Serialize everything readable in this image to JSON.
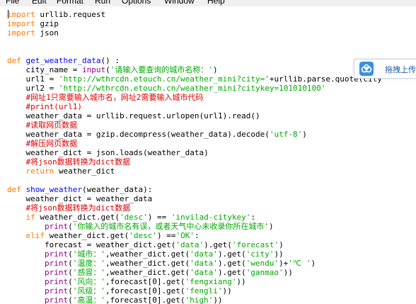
{
  "menu": {
    "items": [
      "File",
      "Edit",
      "Format",
      "Run",
      "Options",
      "Window",
      "Help"
    ]
  },
  "upload_widget": {
    "label": "拖拽上传",
    "icon": "cloud-upload-icon",
    "color": "#3a8ee6"
  },
  "code": {
    "l1_kw": "import",
    "l1_rest": " urllib.request",
    "l2_kw": "import",
    "l2_rest": " gzip",
    "l3_kw": "import",
    "l3_rest": " json",
    "l6_kw": "def",
    "l6_fn": "get_weather_data",
    "l6_rest": "() :",
    "l7_a": "    city_name = ",
    "l7_bi": "input",
    "l7_b": "(",
    "l7_str": "'请输入要查询的城市名称：'",
    "l7_c": ")",
    "l8_a": "    url1 = ",
    "l8_str": "'http://wthrcdn.etouch.cn/weather_mini?city='",
    "l8_b": "+urllib.parse.quote(city",
    "l9_a": "    url2 = ",
    "l9_str": "'http://wthrcdn.etouch.cn/weather_mini?citykey=101010100'",
    "l10_cmt": "    #网址1只需要输入城市名，网址2需要输入城市代码",
    "l11_cmt": "    #print(url1)",
    "l12": "    weather_data = urllib.request.urlopen(url1).read()",
    "l13_cmt": "    #读取网页数据",
    "l14_a": "    weather_data = gzip.decompress(weather_data).decode(",
    "l14_str": "'utf-8'",
    "l14_b": ")",
    "l15_cmt": "    #解压网页数据",
    "l16": "    weather_dict = json.loads(weather_data)",
    "l17_cmt": "    #将json数据转换为dict数据",
    "l18_kw": "    return",
    "l18_rest": " weather_dict",
    "l20_kw": "def",
    "l20_fn": "show_weather",
    "l20_rest": "(weather_data):",
    "l21": "    weather_dict = weather_data",
    "l22_cmt": "    #将json数据转换为dict数据",
    "l23_kw": "    if",
    "l23_a": " weather_dict.get(",
    "l23_str1": "'desc'",
    "l23_b": ") == ",
    "l23_str2": "'invilad-citykey'",
    "l23_c": ":",
    "l24_bi": "        print",
    "l24_a": "(",
    "l24_str": "'你输入的城市名有误，或者天气中心未收录你所在城市'",
    "l24_b": ")",
    "l25_kw": "    elif",
    "l25_a": " weather_dict.get(",
    "l25_str1": "'desc'",
    "l25_b": ") ==",
    "l25_str2": "'OK'",
    "l25_c": ":",
    "l26_a": "        forecast = weather_dict.get(",
    "l26_str1": "'data'",
    "l26_b": ").get(",
    "l26_str2": "'forecast'",
    "l26_c": ")",
    "l27_bi": "        print",
    "l27_a": "(",
    "l27_str1": "'城市：'",
    "l27_b": ",weather_dict.get(",
    "l27_str2": "'data'",
    "l27_c": ").get(",
    "l27_str3": "'city'",
    "l27_d": "))",
    "l28_bi": "        print",
    "l28_a": "(",
    "l28_str1": "'温度：'",
    "l28_b": ",weather_dict.get(",
    "l28_str2": "'data'",
    "l28_c": ").get(",
    "l28_str3": "'wendu'",
    "l28_d": ")+",
    "l28_str4": "'℃ '",
    "l28_e": ")",
    "l29_bi": "        print",
    "l29_a": "(",
    "l29_str1": "'感冒：'",
    "l29_b": ",weather_dict.get(",
    "l29_str2": "'data'",
    "l29_c": ").get(",
    "l29_str3": "'ganmao'",
    "l29_d": "))",
    "l30_bi": "        print",
    "l30_a": "(",
    "l30_str1": "'风向：'",
    "l30_b": ",forecast[0].get(",
    "l30_str2": "'fengxiang'",
    "l30_c": "))",
    "l31_bi": "        print",
    "l31_a": "(",
    "l31_str1": "'风级：'",
    "l31_b": ",forecast[0].get(",
    "l31_str2": "'fengli'",
    "l31_c": "))",
    "l32_bi": "        print",
    "l32_a": "(",
    "l32_str1": "'高温：'",
    "l32_b": ",forecast[0].get(",
    "l32_str2": "'high'",
    "l32_c": "))"
  }
}
